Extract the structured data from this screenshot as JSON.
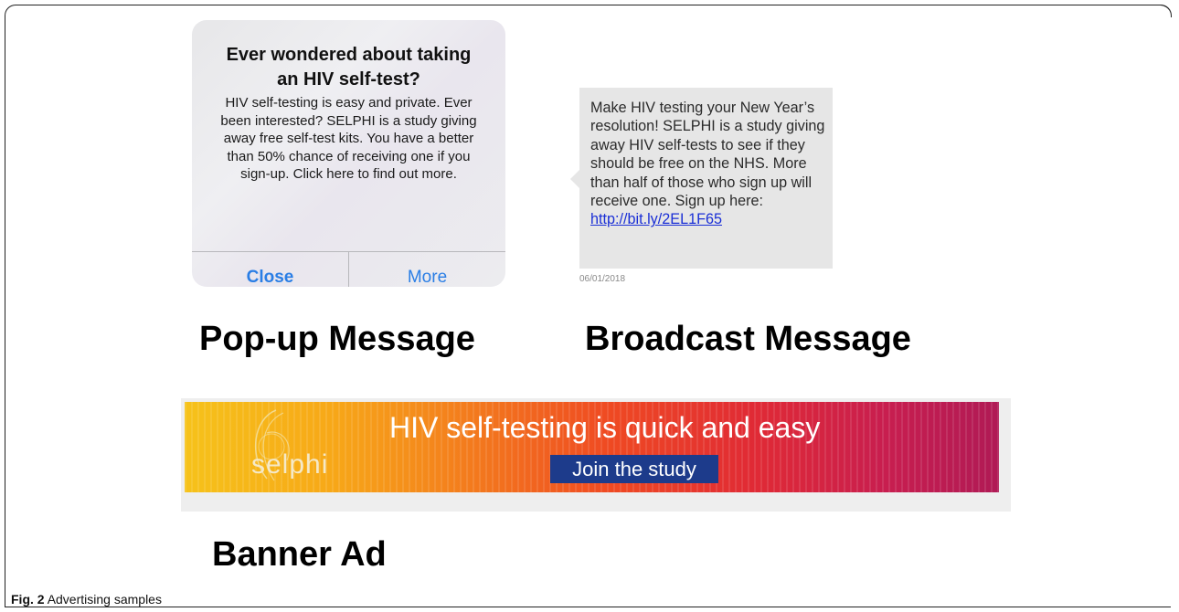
{
  "popup": {
    "title": "Ever wondered about taking an HIV self-test?",
    "body": "HIV self-testing is easy and private. Ever been interested? SELPHI is a study giving away free self-test kits. You have a better than 50% chance of receiving one if you sign-up. Click here to find out more.",
    "close_label": "Close",
    "more_label": "More",
    "accent": "#2a7ee5"
  },
  "broadcast": {
    "text": "Make HIV testing your New Year’s resolution! SELPHI is a study giving away HIV self-tests to see if they should be free on the NHS. More than half of those who sign up will receive one. Sign up here:",
    "link": "http://bit.ly/2EL1F65",
    "date": "06/01/2018"
  },
  "captions": {
    "popup": "Pop-up Message",
    "broadcast": "Broadcast Message",
    "banner": "Banner Ad"
  },
  "banner": {
    "headline": "HIV self-testing is quick and easy",
    "logo": "selphi",
    "cta": "Join the study",
    "cta_color": "#1d3b8b"
  },
  "figure": {
    "label": "Fig. 2",
    "caption": "Advertising samples"
  }
}
